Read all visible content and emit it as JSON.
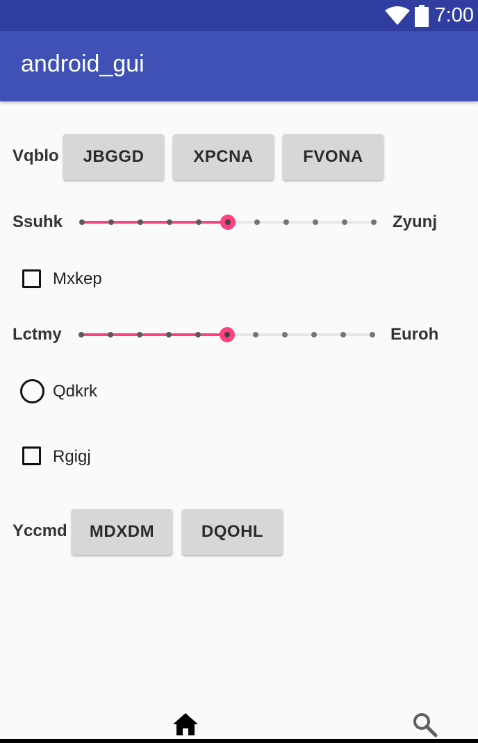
{
  "status_bar": {
    "time": "7:00",
    "icons": [
      "wifi-icon",
      "battery-icon"
    ]
  },
  "app_bar": {
    "title": "android_gui"
  },
  "row1": {
    "label": "Vqblo",
    "buttons": [
      "JBGGD",
      "XPCNA",
      "FVONA"
    ]
  },
  "slider1": {
    "left_label": "Ssuhk",
    "right_label": "Zyunj",
    "value": 5,
    "max": 10
  },
  "checkbox1": {
    "label": "Mxkep",
    "checked": false
  },
  "slider2": {
    "left_label": "Lctmy",
    "right_label": "Euroh",
    "value": 5,
    "max": 10
  },
  "radio1": {
    "label": "Qdkrk",
    "checked": false
  },
  "checkbox2": {
    "label": "Rgigj",
    "checked": false
  },
  "row2": {
    "label": "Yccmd",
    "buttons": [
      "MDXDM",
      "DQOHL"
    ]
  },
  "bottom_nav": {
    "icons": [
      "home-icon",
      "search-icon"
    ]
  },
  "colors": {
    "primary": "#3f51b5",
    "primary_dark": "#303f9f",
    "accent": "#ff4081"
  }
}
